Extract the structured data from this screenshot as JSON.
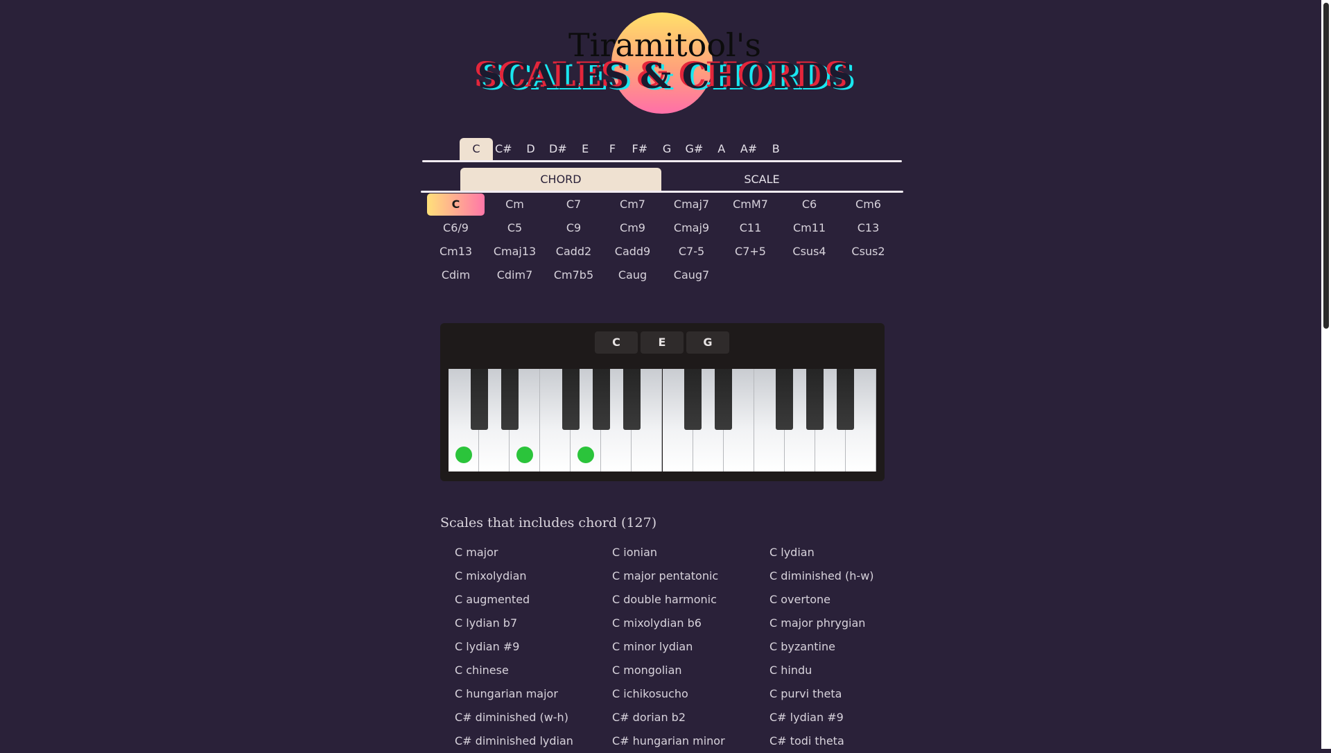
{
  "header": {
    "title_small": "Tiramitool's",
    "title_big": "SCALES & CHORDS"
  },
  "roots": {
    "active": "C",
    "items": [
      "C",
      "C#",
      "D",
      "D#",
      "E",
      "F",
      "F#",
      "G",
      "G#",
      "A",
      "A#",
      "B"
    ]
  },
  "modes": {
    "active": "CHORD",
    "items": [
      "CHORD",
      "SCALE"
    ]
  },
  "chords": {
    "active": "C",
    "items": [
      "C",
      "Cm",
      "C7",
      "Cm7",
      "Cmaj7",
      "CmM7",
      "C6",
      "Cm6",
      "C6/9",
      "C5",
      "C9",
      "Cm9",
      "Cmaj9",
      "C11",
      "Cm11",
      "C13",
      "Cm13",
      "Cmaj13",
      "Cadd2",
      "Cadd9",
      "C7-5",
      "C7+5",
      "Csus4",
      "Csus2",
      "Cdim",
      "Cdim7",
      "Cm7b5",
      "Caug",
      "Caug7"
    ]
  },
  "piano": {
    "notes": [
      "C",
      "E",
      "G"
    ],
    "highlighted_white_keys": [
      0,
      2,
      4
    ]
  },
  "scales": {
    "title": "Scales that includes chord (127)",
    "items": [
      "C major",
      "C ionian",
      "C lydian",
      "C mixolydian",
      "C major pentatonic",
      "C diminished (h-w)",
      "C augmented",
      "C double harmonic",
      "C overtone",
      "C lydian b7",
      "C mixolydian b6",
      "C major phrygian",
      "C lydian #9",
      "C minor lydian",
      "C byzantine",
      "C chinese",
      "C mongolian",
      "C hindu",
      "C hungarian major",
      "C ichikosucho",
      "C purvi theta",
      "C# diminished (w-h)",
      "C# dorian b2",
      "C# lydian #9",
      "C# diminished lydian",
      "C# hungarian minor",
      "C# todi theta"
    ]
  },
  "colors": {
    "background": "#2a2139",
    "tab_active": "#efe1d1",
    "note_dot": "#2bc43b"
  }
}
